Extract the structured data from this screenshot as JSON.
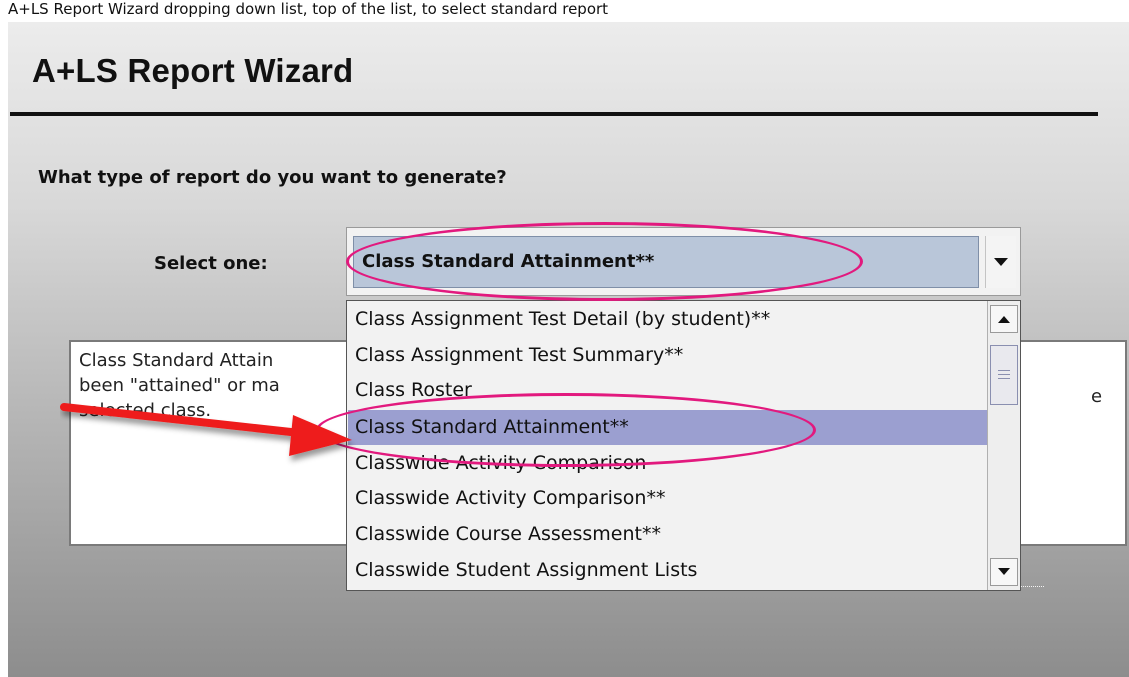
{
  "caption": "A+LS Report Wizard dropping down list, top of the list, to select standard report",
  "wizard": {
    "title": "A+LS Report Wizard",
    "question": "What type of report do you want to generate?",
    "select_label": "Select one:",
    "selected_value": "Class Standard Attainment**"
  },
  "description": {
    "lines": [
      "Class Standard Attain",
      "been \"attained\" or ma",
      "selected class."
    ],
    "tail": "e"
  },
  "dropdown": {
    "items": [
      "Class Assignment Test Detail (by student)**",
      "Class Assignment Test Summary**",
      "Class Roster",
      "Class Standard Attainment**",
      "Classwide Activity Comparison",
      "Classwide Activity Comparison**",
      "Classwide Course Assessment**",
      "Classwide Student Assignment Lists"
    ],
    "selected_index": 3
  },
  "icons": {
    "combo_arrow": "chevron-down-icon",
    "scroll_up": "scroll-up-icon",
    "scroll_down": "scroll-down-icon"
  },
  "colors": {
    "highlight_ellipse": "#e2197e",
    "arrow": "#ee1c1c",
    "selected_item": "#9b9fd0"
  }
}
